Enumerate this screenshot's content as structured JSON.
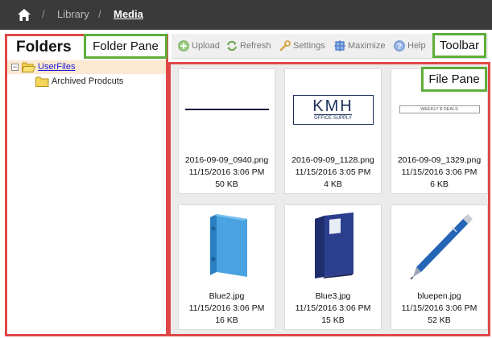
{
  "nav": {
    "home_icon": "home-icon",
    "separator": "/",
    "breadcrumbs": [
      "Library",
      "Media"
    ]
  },
  "folder_pane": {
    "title": "Folders",
    "annotation": "Folder Pane",
    "tree": [
      {
        "label": "UserFiles",
        "expander": "−",
        "icon": "folder-open-icon"
      },
      {
        "label": "Archived Prodcuts",
        "icon": "folder-icon"
      }
    ]
  },
  "toolbar": {
    "annotation": "Toolbar",
    "buttons": [
      {
        "label": "Upload",
        "icon": "upload-icon"
      },
      {
        "label": "Refresh",
        "icon": "refresh-icon"
      },
      {
        "label": "Settings",
        "icon": "settings-icon"
      },
      {
        "label": "Maximize",
        "icon": "maximize-icon"
      },
      {
        "label": "Help",
        "icon": "help-icon"
      }
    ]
  },
  "file_pane": {
    "annotation": "File Pane",
    "files": [
      {
        "name": "2016-09-09_0940.png",
        "date": "11/15/2016 3:06 PM",
        "size": "50 KB",
        "thumb": "line-image"
      },
      {
        "name": "2016-09-09_1128.png",
        "date": "11/15/2016 3:05 PM",
        "size": "4 KB",
        "thumb": "logo-image",
        "logo_text": "KMH",
        "logo_sub": "OFFICE SUPPLY"
      },
      {
        "name": "2016-09-09_1329.png",
        "date": "11/15/2016 3:06 PM",
        "size": "6 KB",
        "thumb": "banner-image",
        "banner_text": "WEEKLY $ DEALS"
      },
      {
        "name": "Blue2.jpg",
        "date": "11/15/2016 3:06 PM",
        "size": "16 KB",
        "thumb": "binder-image"
      },
      {
        "name": "Blue3.jpg",
        "date": "11/15/2016 3:06 PM",
        "size": "15 KB",
        "thumb": "binder-image"
      },
      {
        "name": "bluepen.jpg",
        "date": "11/15/2016 3:06 PM",
        "size": "52 KB",
        "thumb": "pen-image"
      }
    ]
  },
  "colors": {
    "nav_bg": "#3a3a3a",
    "annotation_red": "#e04848",
    "annotation_green": "#5fae3a",
    "link_blue": "#1a1ad6",
    "file_pane_bg": "#ebebeb"
  }
}
